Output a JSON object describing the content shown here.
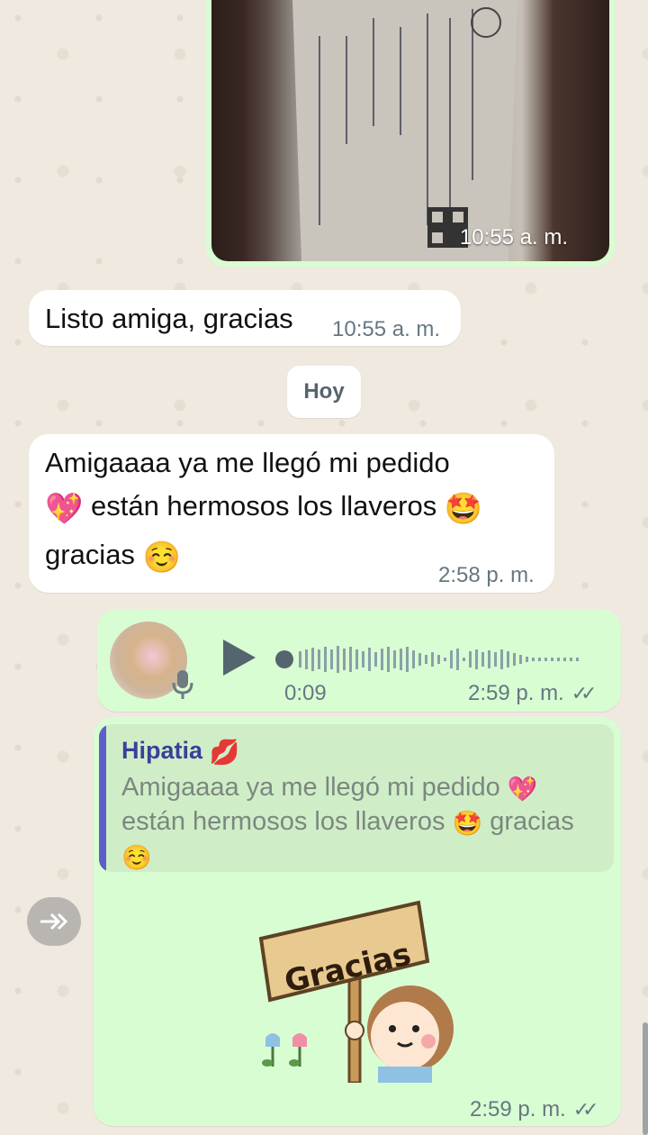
{
  "conversation": {
    "photo_message": {
      "time": "10:55 a. m."
    },
    "message_listo": {
      "text": "Listo amiga, gracias",
      "time": "10:55 a. m."
    },
    "day_separator": "Hoy",
    "message_amiga": {
      "line1": "Amigaaaa ya me llegó mi pedido",
      "line2": "están hermosos los llaveros",
      "line3": "gracias",
      "time": "2:58 p. m."
    },
    "voice_message": {
      "duration": "0:09",
      "time": "2:59 p. m."
    },
    "reply_message": {
      "quoted_author": "Hipatia",
      "quoted_line1": "Amigaaaa ya me llegó mi pedido",
      "quoted_line2": "están hermosos los llaveros",
      "quoted_line2b": "gracias",
      "sticker_text": "Gracias",
      "time": "2:59 p. m."
    }
  },
  "icons": [
    "sparkling-heart-icon",
    "star-struck-icon",
    "smiling-face-icon",
    "kiss-mark-icon",
    "play-icon",
    "microphone-icon",
    "forward-icon",
    "double-check-icon"
  ],
  "colors": {
    "incoming": "#ffffff",
    "outgoing": "#d9fdd3",
    "quote_bar": "#5b5fc7",
    "meta": "#667781"
  }
}
